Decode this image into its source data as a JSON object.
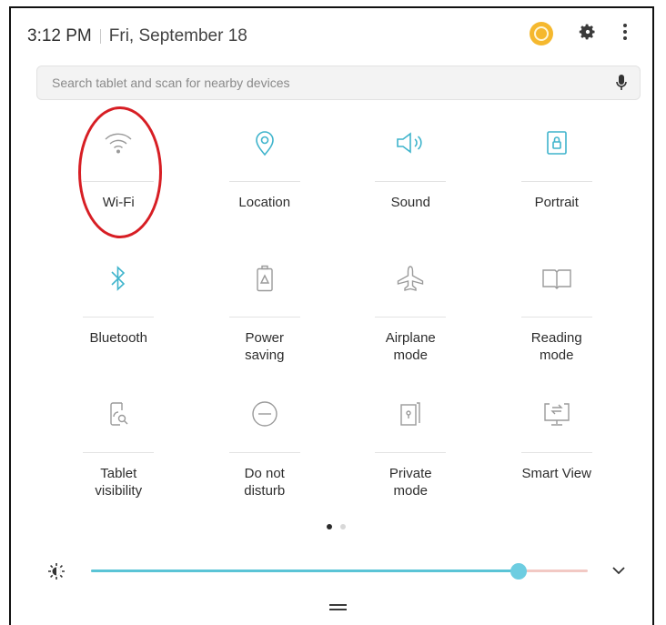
{
  "status": {
    "time": "3:12 PM",
    "date": "Fri, September 18"
  },
  "search": {
    "placeholder": "Search tablet and scan for nearby devices"
  },
  "tiles": [
    {
      "label": "Wi-Fi",
      "icon": "wifi-icon",
      "active": false
    },
    {
      "label": "Location",
      "icon": "location-icon",
      "active": true
    },
    {
      "label": "Sound",
      "icon": "sound-icon",
      "active": true
    },
    {
      "label": "Portrait",
      "icon": "portrait-lock-icon",
      "active": true
    },
    {
      "label": "Bluetooth",
      "icon": "bluetooth-icon",
      "active": true
    },
    {
      "label": "Power\nsaving",
      "icon": "battery-icon",
      "active": false
    },
    {
      "label": "Airplane\nmode",
      "icon": "airplane-icon",
      "active": false
    },
    {
      "label": "Reading\nmode",
      "icon": "book-icon",
      "active": false
    },
    {
      "label": "Tablet\nvisibility",
      "icon": "tablet-visibility-icon",
      "active": false
    },
    {
      "label": "Do not\ndisturb",
      "icon": "do-not-disturb-icon",
      "active": false
    },
    {
      "label": "Private\nmode",
      "icon": "private-mode-icon",
      "active": false
    },
    {
      "label": "Smart View",
      "icon": "smart-view-icon",
      "active": false
    }
  ],
  "pager": {
    "count": 2,
    "current": 0
  },
  "brightness": {
    "level": 0.86
  },
  "colors": {
    "active": "#3fb4cc",
    "inactive": "#9a9a9a",
    "highlight": "#d71e24"
  }
}
